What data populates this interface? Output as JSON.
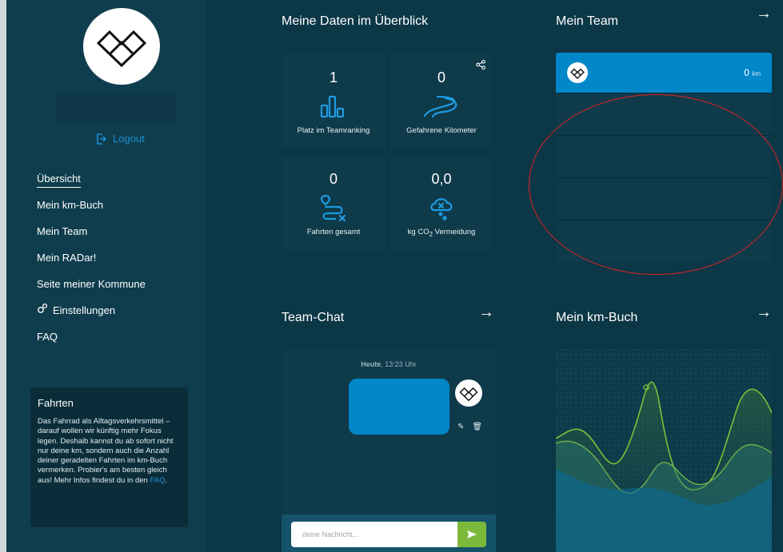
{
  "sidebar": {
    "logout_label": "Logout",
    "nav": [
      {
        "label": "Übersicht",
        "active": true
      },
      {
        "label": "Mein km-Buch"
      },
      {
        "label": "Mein Team"
      },
      {
        "label": "Mein RADar!"
      },
      {
        "label": "Seite meiner Kommune"
      },
      {
        "label": "Einstellungen",
        "icon": "gears-icon"
      },
      {
        "label": "FAQ"
      }
    ],
    "info": {
      "title": "Fahrten",
      "text": "Das Fahrrad als Alltagsverkehrsmittel – darauf wollen wir künftig mehr Fokus legen. Deshalb kannst du ab sofort nicht nur deine km, sondern auch die Anzahl deiner geradelten Fahrten im km-Buch vermerken. Probier's am besten gleich aus! Mehr Infos findest du in den ",
      "link": "FAQ",
      "suffix": "."
    }
  },
  "overview": {
    "title": "Meine Daten im Überblick",
    "stats": [
      {
        "value": "1",
        "label": "Platz im Teamranking",
        "icon": "bar-chart-icon"
      },
      {
        "value": "0",
        "label": "Gefahrene Kilometer",
        "icon": "road-icon"
      },
      {
        "value": "0",
        "label": "Fahrten gesamt",
        "icon": "route-icon"
      },
      {
        "value": "0,0",
        "label_pre": "kg CO",
        "label_sub": "2",
        "label_post": " Vermeidung",
        "icon": "co2-cloud-icon"
      }
    ]
  },
  "team": {
    "title": "Mein Team",
    "top_km": "0",
    "unit": "km"
  },
  "chat": {
    "title": "Team-Chat",
    "time_bold": "Heute",
    "time_rest": ", 13:23 Uhr",
    "placeholder": "deine Nachricht..."
  },
  "kmbuch": {
    "title": "Mein km-Buch"
  },
  "colors": {
    "accent_blue": "#0287c9",
    "send_green": "#7cb93a",
    "annotation_red": "#dd2222"
  }
}
